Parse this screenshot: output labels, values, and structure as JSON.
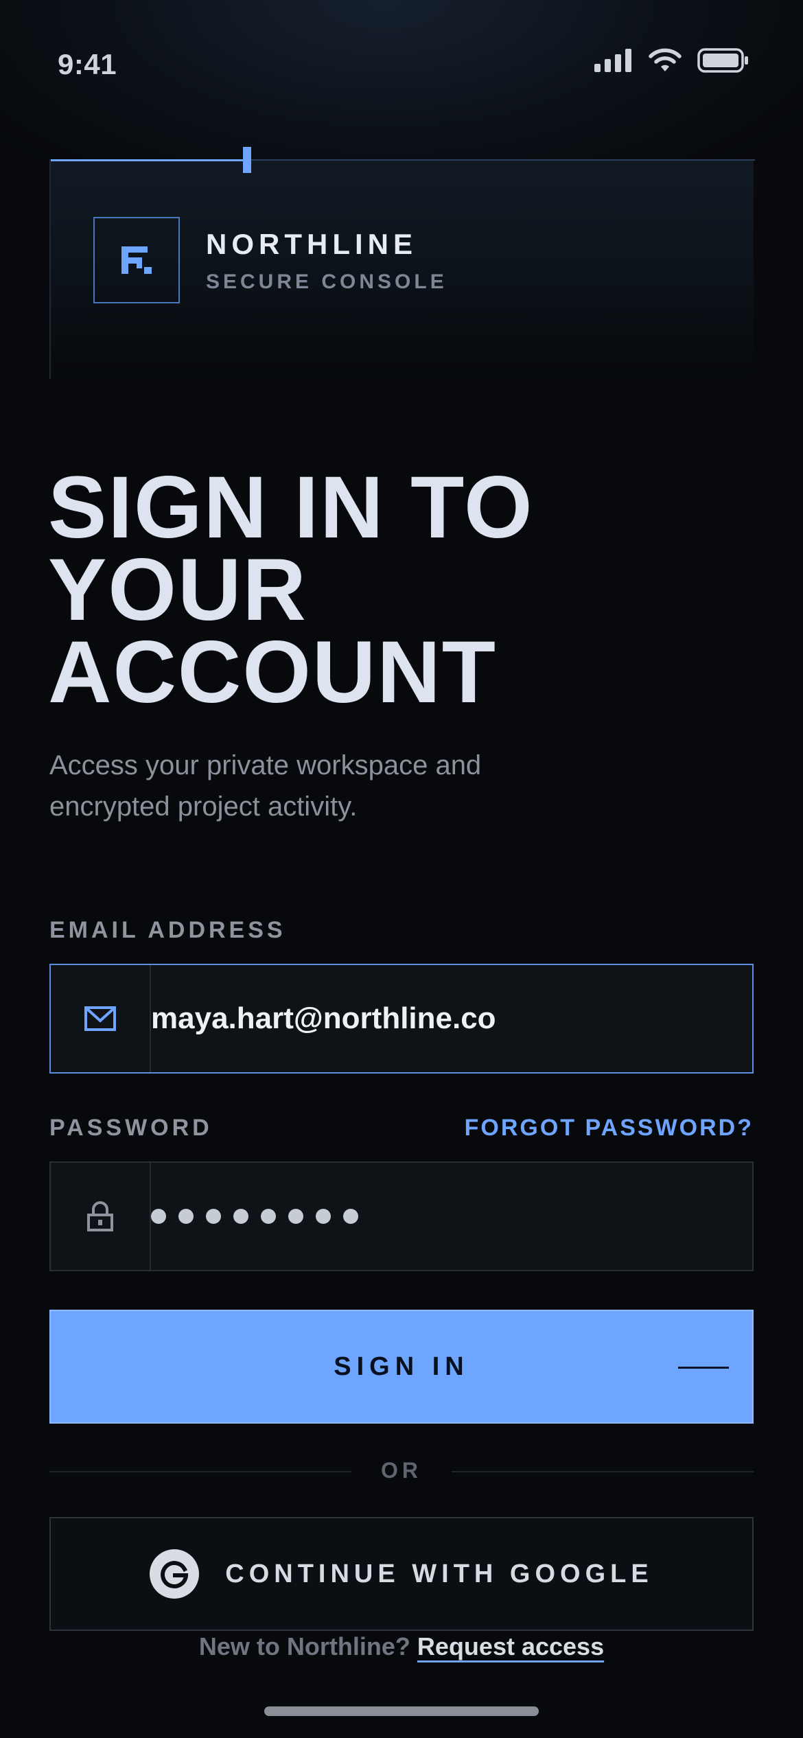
{
  "status_bar": {
    "time": "9:41"
  },
  "brand": {
    "name": "NORTHLINE",
    "subtitle": "SECURE CONSOLE"
  },
  "headline": {
    "lines": [
      "SIGN IN TO",
      "YOUR",
      "ACCOUNT"
    ]
  },
  "subtitle": {
    "lines": [
      "Access your private workspace and",
      "encrypted project activity."
    ]
  },
  "form": {
    "email_label": "EMAIL ADDRESS",
    "email_value": "maya.hart@northline.co",
    "password_label": "PASSWORD",
    "forgot_link": "FORGOT PASSWORD?",
    "password_mask_count": 8,
    "signin_label": "SIGN IN",
    "or_label": "OR",
    "google_label": "CONTINUE WITH GOOGLE"
  },
  "footer": {
    "prompt": "New to Northline?",
    "link": "Request access"
  },
  "colors": {
    "accent": "#6ea6ff",
    "background": "#07090c"
  },
  "icons": {
    "email": "mail-icon",
    "password": "lock-icon",
    "google": "google-icon",
    "logo": "northline-logo-icon"
  }
}
